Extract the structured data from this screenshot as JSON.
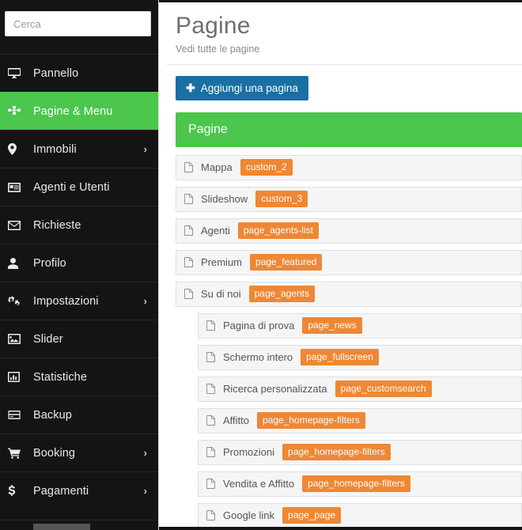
{
  "sidebar": {
    "search": {
      "placeholder": "Cerca",
      "value": ""
    },
    "items": [
      {
        "label": "Pannello",
        "icon": "desktop-icon",
        "active": false,
        "has_caret": false
      },
      {
        "label": "Pagine & Menu",
        "icon": "sitemap-icon",
        "active": true,
        "has_caret": false
      },
      {
        "label": "Immobili",
        "icon": "map-marker-icon",
        "active": false,
        "has_caret": true
      },
      {
        "label": "Agenti e Utenti",
        "icon": "id-card-icon",
        "active": false,
        "has_caret": false
      },
      {
        "label": "Richieste",
        "icon": "envelope-icon",
        "active": false,
        "has_caret": false
      },
      {
        "label": "Profilo",
        "icon": "user-icon",
        "active": false,
        "has_caret": false
      },
      {
        "label": "Impostazioni",
        "icon": "cogs-icon",
        "active": false,
        "has_caret": true
      },
      {
        "label": "Slider",
        "icon": "image-icon",
        "active": false,
        "has_caret": false
      },
      {
        "label": "Statistiche",
        "icon": "bar-chart-icon",
        "active": false,
        "has_caret": false
      },
      {
        "label": "Backup",
        "icon": "hdd-icon",
        "active": false,
        "has_caret": false
      },
      {
        "label": "Booking",
        "icon": "cart-icon",
        "active": false,
        "has_caret": true
      },
      {
        "label": "Pagamenti",
        "icon": "dollar-icon",
        "active": false,
        "has_caret": true
      }
    ]
  },
  "header": {
    "title": "Pagine",
    "subtitle": "Vedi tutte le pagine"
  },
  "toolbar": {
    "add_page_label": "Aggiungi una pagina",
    "add_page_plus": "✚"
  },
  "panel": {
    "title": "Pagine",
    "rows": [
      {
        "label": "Mappa",
        "badge": "custom_2",
        "indent": false
      },
      {
        "label": "Slideshow",
        "badge": "custom_3",
        "indent": false
      },
      {
        "label": "Agenti",
        "badge": "page_agents-list",
        "indent": false
      },
      {
        "label": "Premium",
        "badge": "page_featured",
        "indent": false
      },
      {
        "label": "Su di noi",
        "badge": "page_agents",
        "indent": false
      },
      {
        "label": "Pagina di prova",
        "badge": "page_news",
        "indent": true
      },
      {
        "label": "Schermo intero",
        "badge": "page_fullscreen",
        "indent": true
      },
      {
        "label": "Ricerca personalizzata",
        "badge": "page_customsearch",
        "indent": true
      },
      {
        "label": "Affitto",
        "badge": "page_homepage-filters",
        "indent": true
      },
      {
        "label": "Promozioni",
        "badge": "page_homepage-filters",
        "indent": true
      },
      {
        "label": "Vendita e Affitto",
        "badge": "page_homepage-filters",
        "indent": true
      },
      {
        "label": "Google link",
        "badge": "page_page",
        "indent": true
      }
    ]
  },
  "colors": {
    "accent_green": "#4cc64c",
    "sidebar_bg": "#141414",
    "button_blue": "#1a6fa3",
    "badge_orange": "#ef8733",
    "row_bg": "#f5f5f5"
  }
}
